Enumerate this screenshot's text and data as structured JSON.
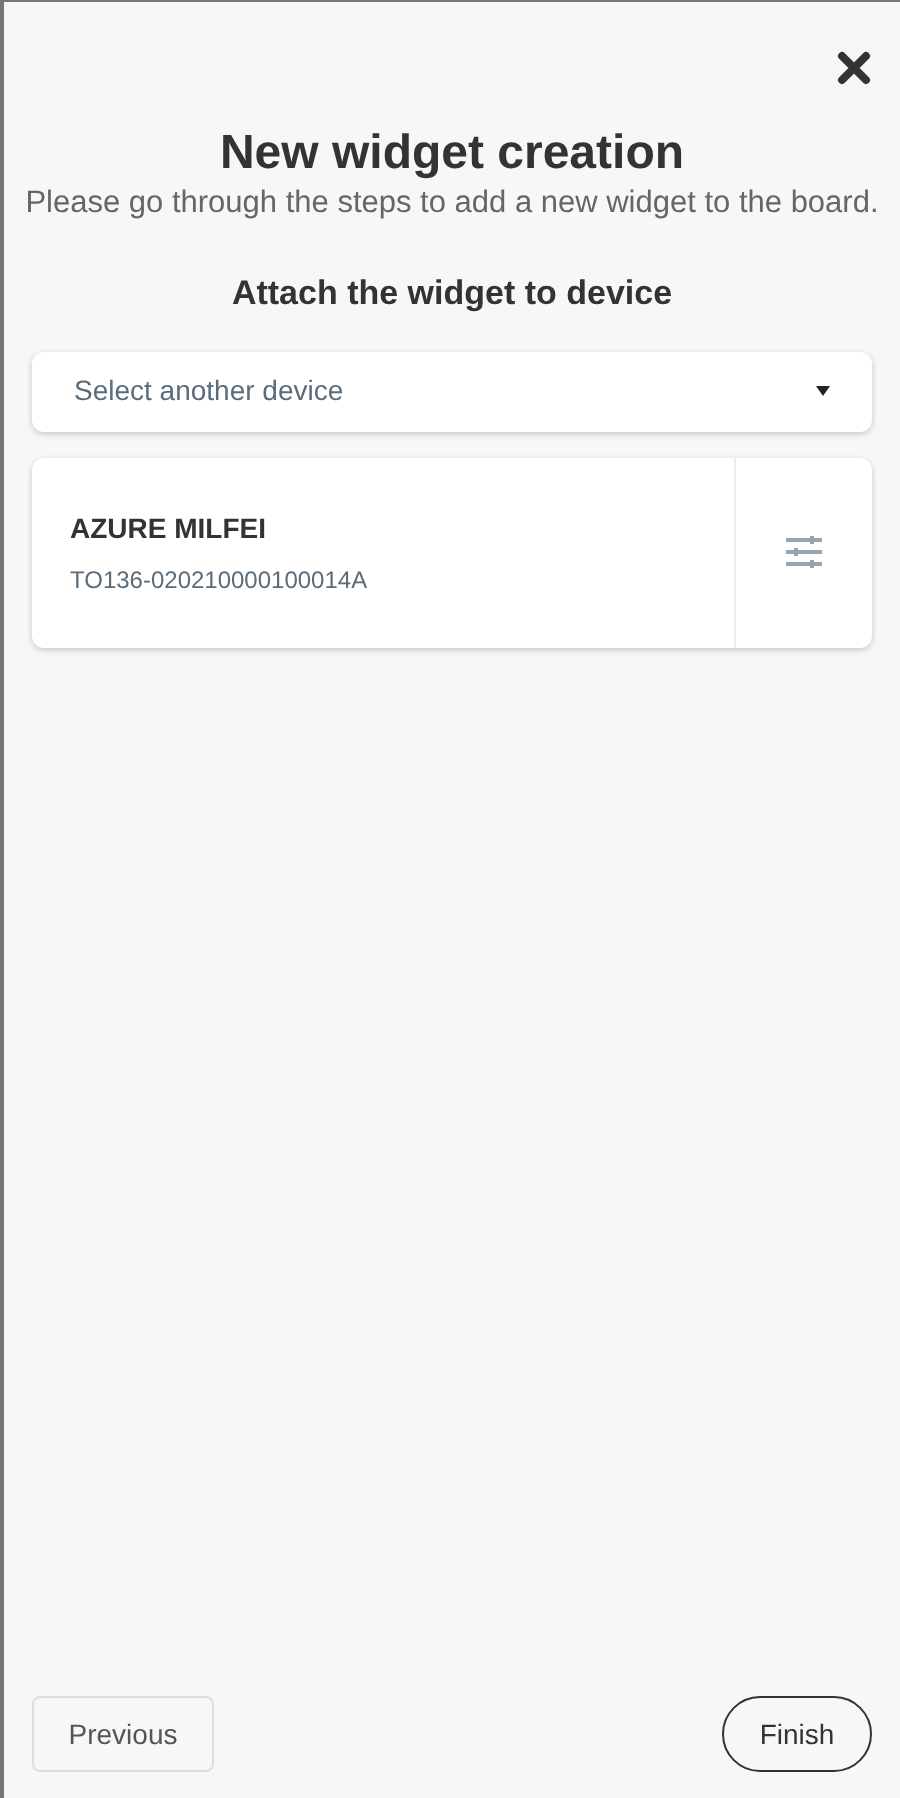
{
  "title": "New widget creation",
  "subtitle": "Please go through the steps to add a new widget to the board.",
  "step_title": "Attach the widget to device",
  "device_select": {
    "placeholder": "Select another device"
  },
  "device": {
    "name": "AZURE MILFEI",
    "id": "TO136-020210000100014A"
  },
  "buttons": {
    "previous": "Previous",
    "finish": "Finish"
  }
}
